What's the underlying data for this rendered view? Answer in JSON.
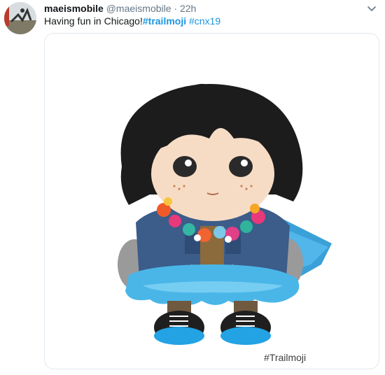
{
  "tweet": {
    "author_name": "maeismobile",
    "author_handle": "@maeismobile",
    "separator": "·",
    "timestamp": "22h",
    "text_prefix": "Having fun in Chicago!",
    "hashtags": [
      "#trailmoji",
      "#cnx19"
    ],
    "media_caption": "#Trailmoji"
  },
  "icons": {
    "more": "chevron-down-icon",
    "avatar": "avatar-photo"
  },
  "colors": {
    "hashtag": "#1b95e0",
    "meta": "#657786",
    "cape": "#3aa0d8",
    "jacket": "#3c5c8a"
  }
}
